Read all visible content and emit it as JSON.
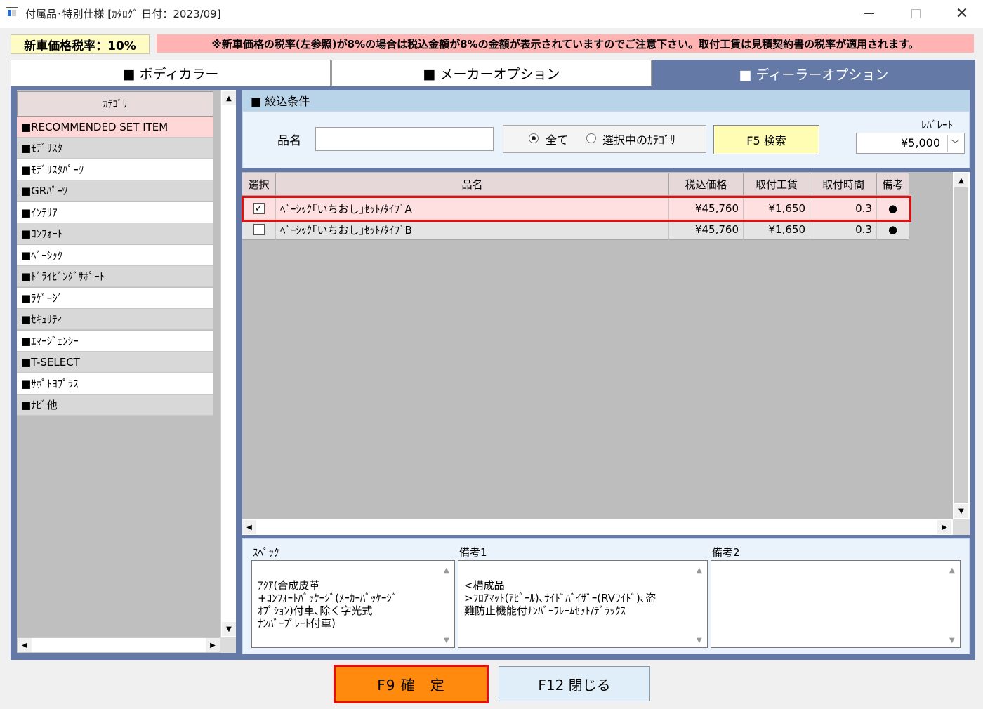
{
  "window": {
    "title": "付属品･特別仕様 [ｶﾀﾛｸﾞ 日付：2023/09]",
    "close_glyph": "✕"
  },
  "tax": {
    "rate_label": "新車価格税率：10%",
    "notice": "※新車価格の税率(左参照)が8%の場合は税込金額が8%の金額が表示されていますのでご注意下さい。取付工賃は見積契約書の税率が適用されます。"
  },
  "tabs": [
    {
      "label": "■ ボディカラー"
    },
    {
      "label": "■ メーカーオプション"
    },
    {
      "label": "■ ディーラーオプション",
      "active": true
    }
  ],
  "category": {
    "header": "ｶﾃｺﾞﾘ",
    "items": [
      {
        "label": "■RECOMMENDED SET ITEM",
        "selected": true
      },
      {
        "label": "■ﾓﾃﾞﾘｽﾀ"
      },
      {
        "label": "■ﾓﾃﾞﾘｽﾀﾊﾟｰﾂ"
      },
      {
        "label": "■GRﾊﾟｰﾂ"
      },
      {
        "label": "■ｲﾝﾃﾘｱ"
      },
      {
        "label": "■ｺﾝﾌｫｰﾄ"
      },
      {
        "label": "■ﾍﾞｰｼｯｸ"
      },
      {
        "label": "■ﾄﾞﾗｲﾋﾞﾝｸﾞｻﾎﾟｰﾄ"
      },
      {
        "label": "■ﾗｹﾞｰｼﾞ"
      },
      {
        "label": "■ｾｷｭﾘﾃｨ"
      },
      {
        "label": "■ｴﾏｰｼﾞｪﾝｼｰ"
      },
      {
        "label": "■T-SELECT"
      },
      {
        "label": "■ｻﾎﾟﾄﾖﾌﾟﾗｽ"
      },
      {
        "label": "■ﾅﾋﾞ他"
      }
    ]
  },
  "filter": {
    "header": "■ 絞込条件",
    "name_label": "品名",
    "name_value": "",
    "radio_all": "全て",
    "radio_selected_category": "選択中のｶﾃｺﾞﾘ",
    "search_button": "F5 検索",
    "lever_label": "ﾚﾊﾞﾚｰﾄ",
    "lever_value": "¥5,000"
  },
  "grid": {
    "columns": [
      "選択",
      "品名",
      "税込価格",
      "取付工賃",
      "取付時間",
      "備考"
    ],
    "rows": [
      {
        "checked": "✓",
        "name": "ﾍﾞｰｼｯｸ｢いちおし｣ｾｯﾄ/ﾀｲﾌﾟA",
        "price": "¥45,760",
        "labor": "¥1,650",
        "time": "0.3",
        "note": "●",
        "selected": true
      },
      {
        "checked": "",
        "name": "ﾍﾞｰｼｯｸ｢いちおし｣ｾｯﾄ/ﾀｲﾌﾟB",
        "price": "¥45,760",
        "labor": "¥1,650",
        "time": "0.3",
        "note": "●"
      }
    ]
  },
  "notes": {
    "spec_label": "ｽﾍﾟｯｸ",
    "spec_text": "ｱｸｱ(合成皮革\n+ｺﾝﾌｫｰﾄﾊﾟｯｹｰｼﾞ(ﾒｰｶｰﾊﾟｯｹｰｼﾞ\nｵﾌﾟｼｮﾝ)付車､除く字光式\nﾅﾝﾊﾞｰﾌﾟﾚｰﾄ付車)",
    "note1_label": "備考1",
    "note1_text": "<構成品\n>ﾌﾛｱﾏｯﾄ(ｱﾋﾟｰﾙ)､ｻｲﾄﾞﾊﾞｲｻﾞｰ(RVﾜｲﾄﾞ)､盗\n難防止機能付ﾅﾝﾊﾞｰﾌﾚｰﾑｾｯﾄ/ﾃﾞﾗｯｸｽ",
    "note2_label": "備考2",
    "note2_text": ""
  },
  "buttons": {
    "confirm": "F9 確　定",
    "close": "F12 閉じる"
  }
}
